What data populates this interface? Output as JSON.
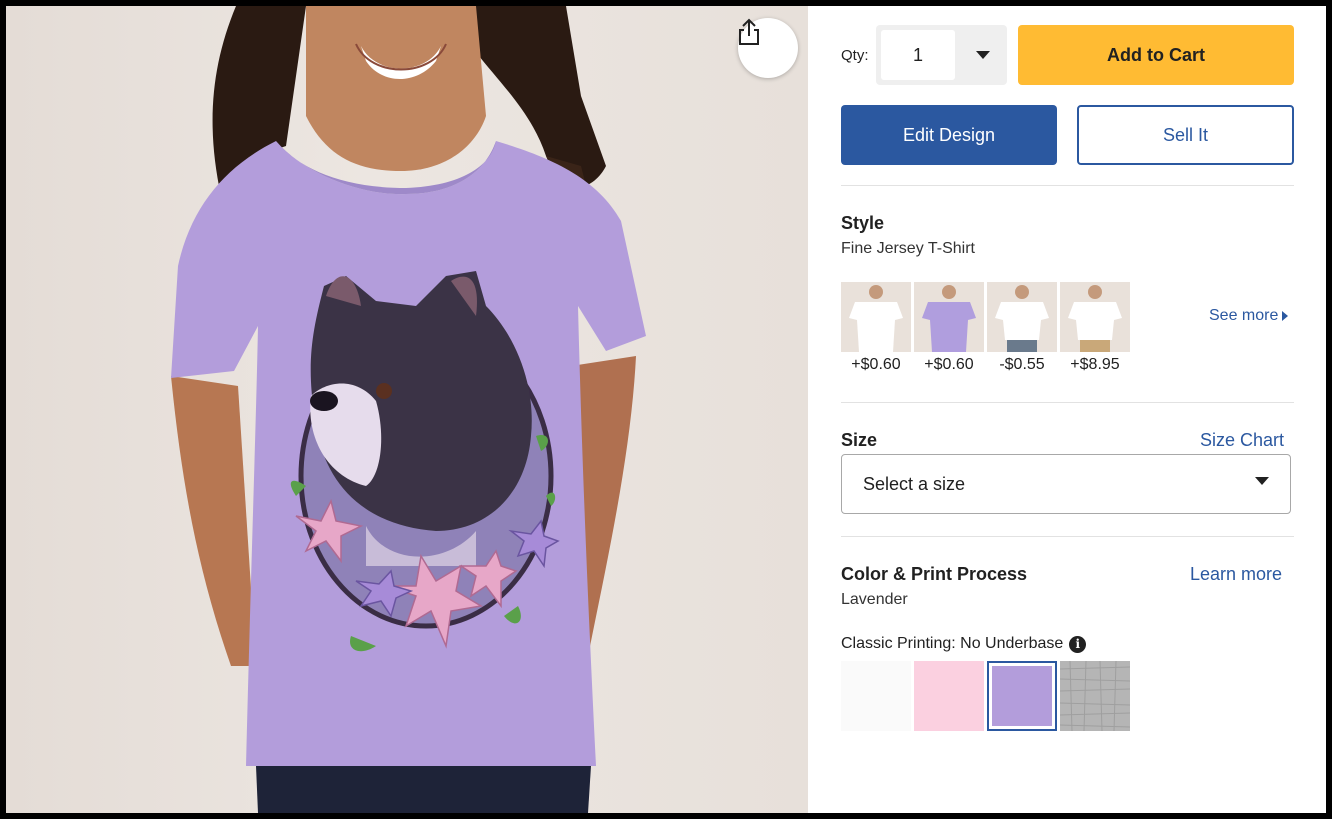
{
  "product_image": {
    "alt": "Girl wearing lavender t-shirt with French bulldog and flowers print",
    "share_icon": "share-icon"
  },
  "qty": {
    "label": "Qty:",
    "value": "1",
    "caret_icon": "chevron-down-icon"
  },
  "buttons": {
    "add_to_cart": "Add to Cart",
    "edit_design": "Edit Design",
    "sell_it": "Sell It"
  },
  "style": {
    "title": "Style",
    "selected": "Fine Jersey T-Shirt",
    "options": [
      {
        "price": "+$0.60",
        "shirt_color": "#ffffff"
      },
      {
        "price": "+$0.60",
        "shirt_color": "#b09ede"
      },
      {
        "price": "-$0.55",
        "shirt_color": "#ffffff"
      },
      {
        "price": "+$8.95",
        "shirt_color": "#ffffff"
      }
    ],
    "see_more": "See more",
    "see_more_icon": "caret-right-icon"
  },
  "size": {
    "title": "Size",
    "chart_link": "Size Chart",
    "select_value": "Select a size",
    "caret_icon": "chevron-down-icon"
  },
  "color": {
    "title": "Color & Print Process",
    "learn_more": "Learn more",
    "selected": "Lavender",
    "print_process": "Classic Printing: No Underbase",
    "info_icon": "info-icon",
    "swatches": [
      {
        "name": "White",
        "hex": "#fafafa"
      },
      {
        "name": "Pink",
        "hex": "#fbd0e0"
      },
      {
        "name": "Lavender",
        "hex": "#b39ddb",
        "selected": true
      },
      {
        "name": "Heather Gray",
        "hex": "#b7b7b7"
      }
    ]
  },
  "colors": {
    "brand_blue": "#2b58a0",
    "add_to_cart_yellow": "#ffbb33",
    "lavender": "#b39ddb"
  }
}
